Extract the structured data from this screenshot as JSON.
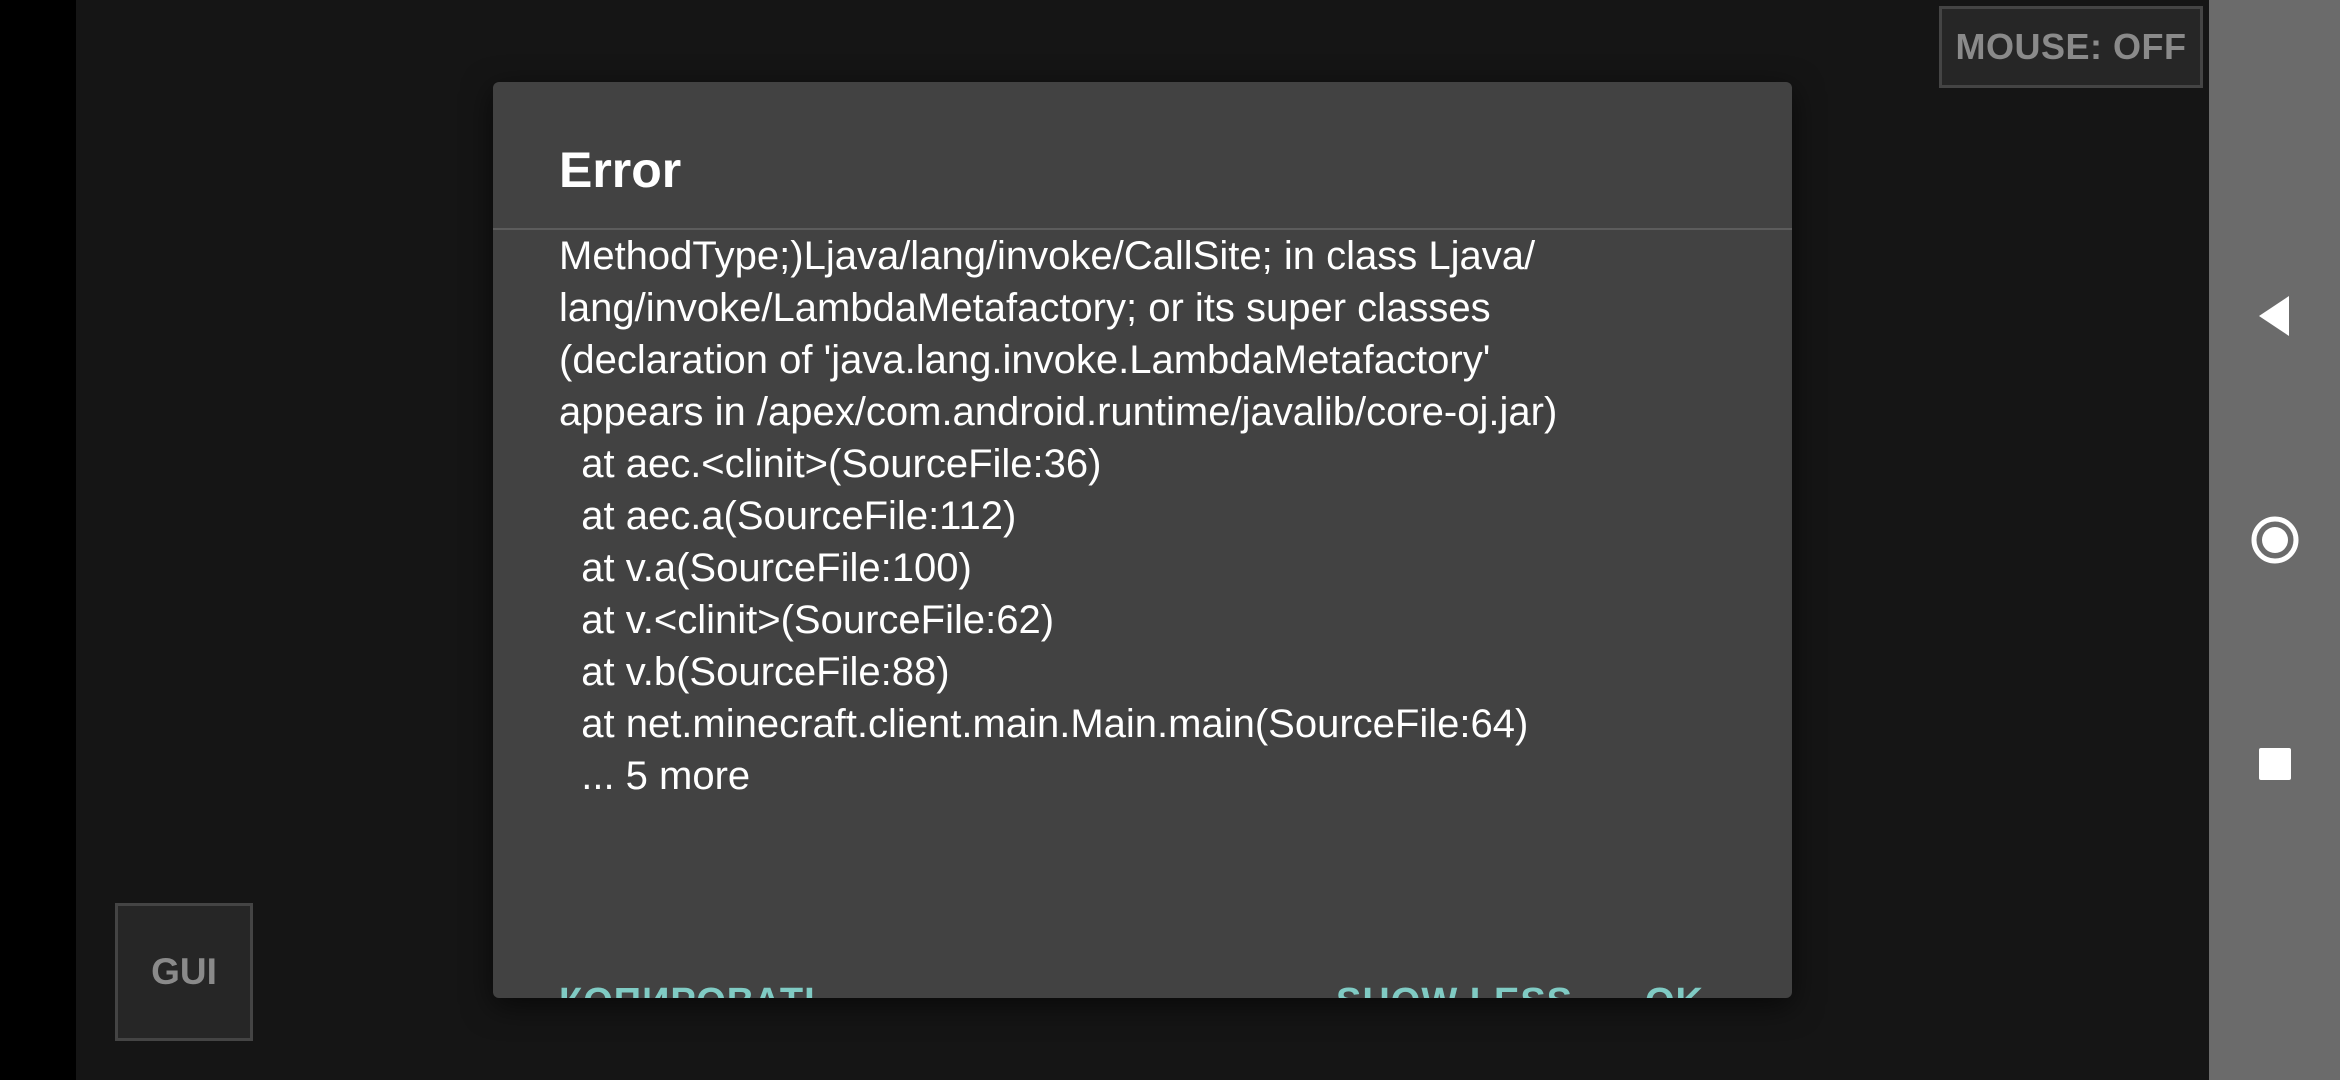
{
  "overlay": {
    "mouse_toggle_label": "MOUSE: OFF",
    "gui_button_label": "GUI"
  },
  "dialog": {
    "title": "Error",
    "message_lines": [
      "MethodType;)Ljava/lang/invoke/CallSite; in class Ljava/",
      "lang/invoke/LambdaMetafactory; or its super classes",
      "(declaration of 'java.lang.invoke.LambdaMetafactory'",
      "appears in /apex/com.android.runtime/javalib/core-oj.jar)",
      "  at aec.<clinit>(SourceFile:36)",
      "  at aec.a(SourceFile:112)",
      "  at v.a(SourceFile:100)",
      "  at v.<clinit>(SourceFile:62)",
      "  at v.b(SourceFile:88)",
      "  at net.minecraft.client.main.Main.main(SourceFile:64)",
      "  ... 5 more"
    ],
    "buttons": {
      "copy": "КОПИРОВАТЬ",
      "show_less": "SHOW LESS",
      "ok": "OK"
    }
  },
  "nav_bar": {
    "icons": [
      "back-icon",
      "home-icon",
      "recents-icon"
    ]
  },
  "colors": {
    "dialog_bg": "#424242",
    "accent": "#80cbc4",
    "nav_bar_bg": "#6b6b6b",
    "game_bg": "#151515"
  }
}
